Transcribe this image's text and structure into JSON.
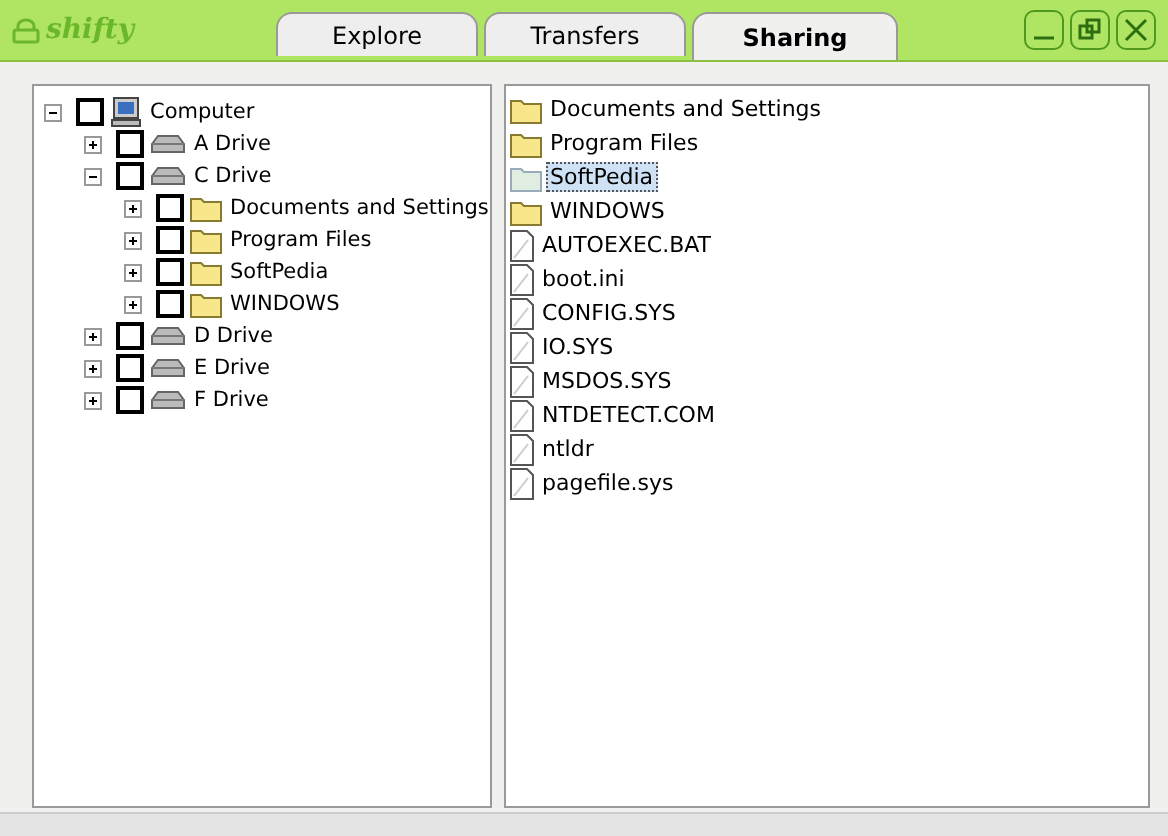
{
  "app": {
    "title": "shifty"
  },
  "tabs": [
    {
      "label": "Explore",
      "selected": false
    },
    {
      "label": "Transfers",
      "selected": false
    },
    {
      "label": "Sharing",
      "selected": true
    }
  ],
  "tree": [
    {
      "label": "Computer",
      "kind": "computer",
      "expanded": true,
      "checked": false,
      "children": [
        {
          "label": "A Drive",
          "kind": "drive",
          "expanded": false,
          "checked": false
        },
        {
          "label": "C Drive",
          "kind": "drive",
          "expanded": true,
          "checked": false,
          "children": [
            {
              "label": "Documents and Settings",
              "kind": "folder",
              "expanded": false,
              "checked": false
            },
            {
              "label": "Program Files",
              "kind": "folder",
              "expanded": false,
              "checked": false
            },
            {
              "label": "SoftPedia",
              "kind": "folder",
              "expanded": false,
              "checked": false
            },
            {
              "label": "WINDOWS",
              "kind": "folder",
              "expanded": false,
              "checked": false
            }
          ]
        },
        {
          "label": "D Drive",
          "kind": "drive",
          "expanded": false,
          "checked": false
        },
        {
          "label": "E Drive",
          "kind": "drive",
          "expanded": false,
          "checked": false
        },
        {
          "label": "F Drive",
          "kind": "drive",
          "expanded": false,
          "checked": false
        }
      ]
    }
  ],
  "files": [
    {
      "label": "Documents and Settings",
      "kind": "folder",
      "selected": false
    },
    {
      "label": "Program Files",
      "kind": "folder",
      "selected": false
    },
    {
      "label": "SoftPedia",
      "kind": "folder",
      "selected": true
    },
    {
      "label": "WINDOWS",
      "kind": "folder",
      "selected": false
    },
    {
      "label": "AUTOEXEC.BAT",
      "kind": "file",
      "selected": false
    },
    {
      "label": "boot.ini",
      "kind": "file",
      "selected": false
    },
    {
      "label": "CONFIG.SYS",
      "kind": "file",
      "selected": false
    },
    {
      "label": "IO.SYS",
      "kind": "file",
      "selected": false
    },
    {
      "label": "MSDOS.SYS",
      "kind": "file",
      "selected": false
    },
    {
      "label": "NTDETECT.COM",
      "kind": "file",
      "selected": false
    },
    {
      "label": "ntldr",
      "kind": "file",
      "selected": false
    },
    {
      "label": "pagefile.sys",
      "kind": "file",
      "selected": false
    }
  ]
}
